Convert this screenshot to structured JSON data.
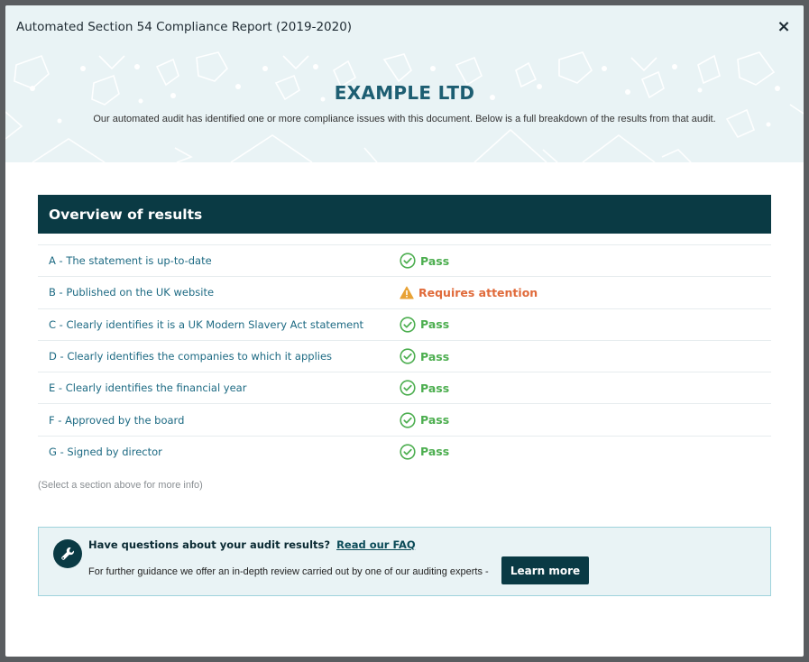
{
  "modal": {
    "title": "Automated Section 54 Compliance Report (2019-2020)",
    "close_label": "×"
  },
  "hero": {
    "company": "EXAMPLE LTD",
    "intro": "Our automated audit has identified one or more compliance issues with this document. Below is a full breakdown of the results from that audit."
  },
  "overview": {
    "heading": "Overview of results",
    "rows": [
      {
        "label": "A - The statement is up-to-date",
        "status": "Pass",
        "type": "pass",
        "icon": "check-circle-icon"
      },
      {
        "label": "B - Published on the UK website",
        "status": "Requires attention",
        "type": "warn",
        "icon": "warning-icon"
      },
      {
        "label": "C - Clearly identifies it is a UK Modern Slavery Act statement",
        "status": "Pass",
        "type": "pass",
        "icon": "check-circle-icon"
      },
      {
        "label": "D - Clearly identifies the companies to which it applies",
        "status": "Pass",
        "type": "pass",
        "icon": "check-circle-icon"
      },
      {
        "label": "E - Clearly identifies the financial year",
        "status": "Pass",
        "type": "pass",
        "icon": "check-circle-icon"
      },
      {
        "label": "F - Approved by the board",
        "status": "Pass",
        "type": "pass",
        "icon": "check-circle-icon"
      },
      {
        "label": "G - Signed by director",
        "status": "Pass",
        "type": "pass",
        "icon": "check-circle-icon"
      }
    ],
    "hint": "(Select a section above for more info)"
  },
  "faq": {
    "question": "Have questions about your audit results?",
    "faq_link": "Read our FAQ",
    "guidance": "For further guidance we offer an in-depth review carried out by one of our auditing experts -",
    "button": "Learn more",
    "icon": "wrench-icon"
  },
  "colors": {
    "dark_teal": "#0a3a44",
    "heading_teal": "#1d5e72",
    "link_blue": "#1d6a83",
    "pass_green": "#4cae4f",
    "warn_orange": "#e06a3a",
    "warn_icon": "#e8a235",
    "hero_bg": "#e9f3f5"
  }
}
